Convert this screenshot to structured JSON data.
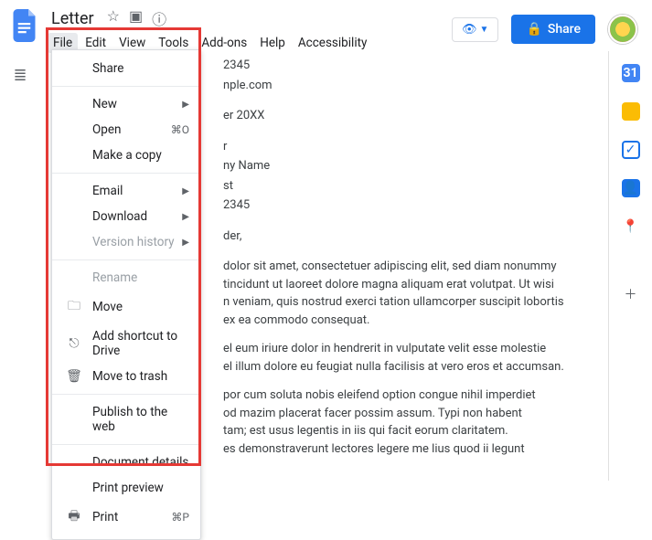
{
  "doc_title": "Letter",
  "menus": {
    "file": "File",
    "edit": "Edit",
    "view": "View",
    "tools": "Tools",
    "addons": "Add-ons",
    "help": "Help",
    "accessibility": "Accessibility"
  },
  "share_button": "Share",
  "file_menu": {
    "share": "Share",
    "new": "New",
    "open": "Open",
    "open_shortcut": "⌘O",
    "make_copy": "Make a copy",
    "email": "Email",
    "download": "Download",
    "version_history": "Version history",
    "rename": "Rename",
    "move": "Move",
    "add_shortcut": "Add shortcut to Drive",
    "move_to_trash": "Move to trash",
    "publish": "Publish to the web",
    "doc_details": "Document details",
    "print_preview": "Print preview",
    "print": "Print",
    "print_shortcut": "⌘P"
  },
  "doc_body": {
    "line_zip1": "2345",
    "line_email_frag": "nple.com",
    "line_date": "er 20XX",
    "line_r": "r",
    "line_name": "ny Name",
    "line_st": "st",
    "line_zip2": "2345",
    "line_salutation": "der,",
    "para1_1": "dolor sit amet, consectetuer adipiscing elit, sed diam nonummy",
    "para1_2": "tincidunt ut laoreet dolore magna aliquam erat volutpat. Ut wisi",
    "para1_3": "n veniam, quis nostrud exerci tation ullamcorper suscipit lobortis",
    "para1_4": "ex ea commodo consequat.",
    "para2_1": "el eum iriure dolor in hendrerit in vulputate velit esse molestie",
    "para2_2": "el illum dolore eu feugiat nulla facilisis at vero eros et accumsan.",
    "para3_1": "por cum soluta nobis eleifend option congue nihil imperdiet",
    "para3_2": "od mazim placerat facer possim assum. Typi non habent",
    "para3_3": "tam; est usus legentis in iis qui facit eorum claritatem.",
    "para3_4": "es demonstraverunt lectores legere me lius quod ii legunt"
  },
  "side_calendar_day": "31"
}
